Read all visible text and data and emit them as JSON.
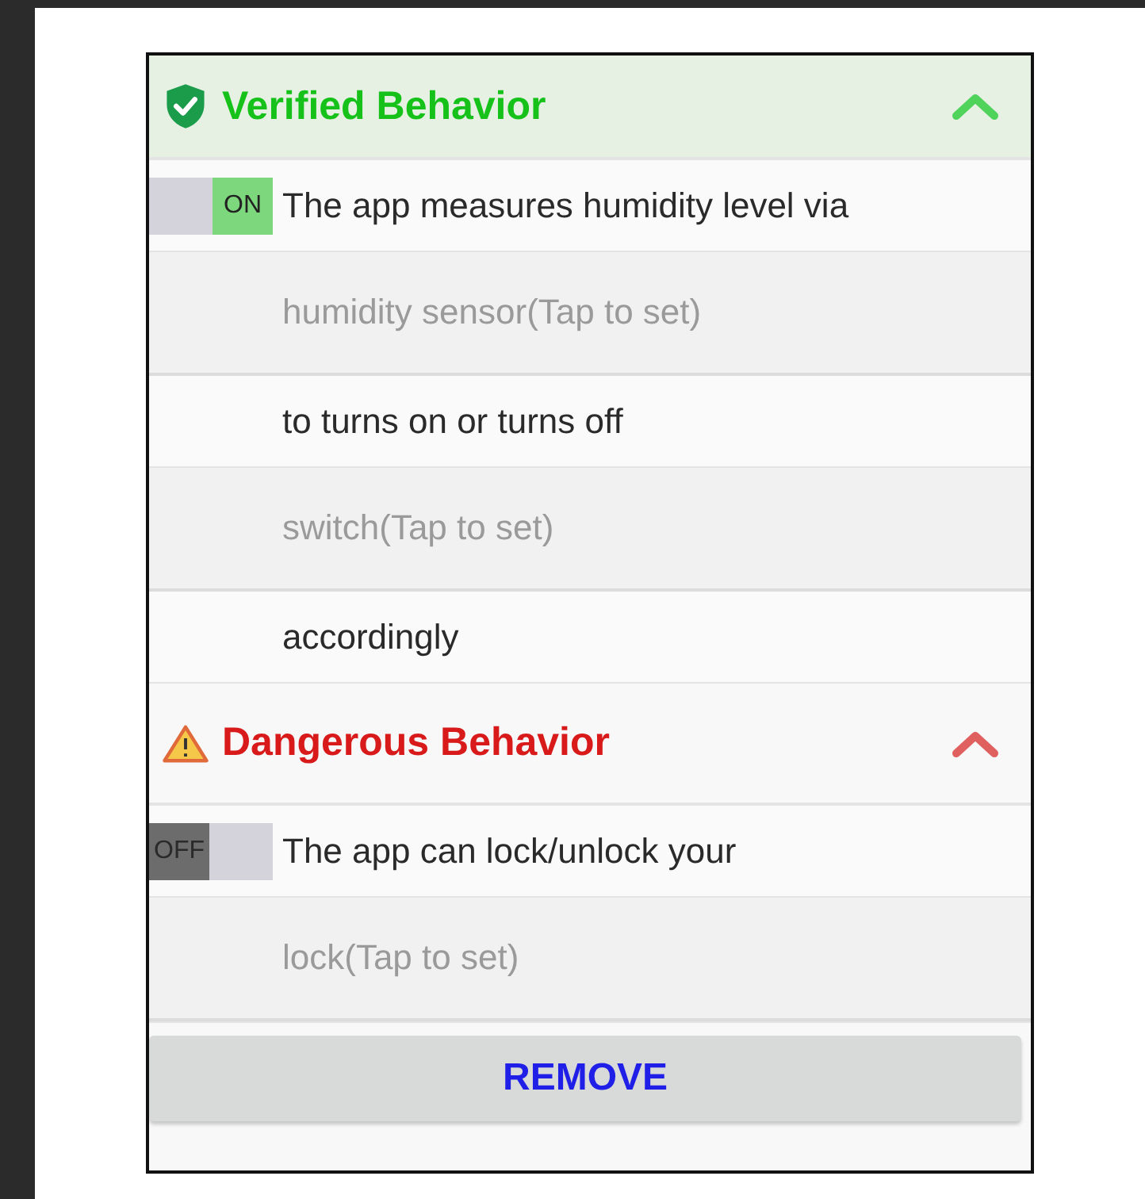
{
  "sections": [
    {
      "kind": "verified",
      "title": "Verified Behavior",
      "expanded": true,
      "rows": [
        {
          "kind": "rule",
          "text": "The app measures humidity level via",
          "toggle": {
            "label": "ON",
            "on": true
          }
        },
        {
          "kind": "slot",
          "text": "humidity sensor(Tap to set)"
        },
        {
          "kind": "rule",
          "text": "to turns on or turns off"
        },
        {
          "kind": "slot",
          "text": "switch(Tap to set)"
        },
        {
          "kind": "rule",
          "text": "accordingly"
        }
      ]
    },
    {
      "kind": "dangerous",
      "title": "Dangerous Behavior",
      "expanded": true,
      "rows": [
        {
          "kind": "rule",
          "text": "The app can lock/unlock your",
          "toggle": {
            "label": "OFF",
            "on": false
          }
        },
        {
          "kind": "slot",
          "text": "lock(Tap to set)"
        }
      ]
    }
  ],
  "button": "REMOVE"
}
